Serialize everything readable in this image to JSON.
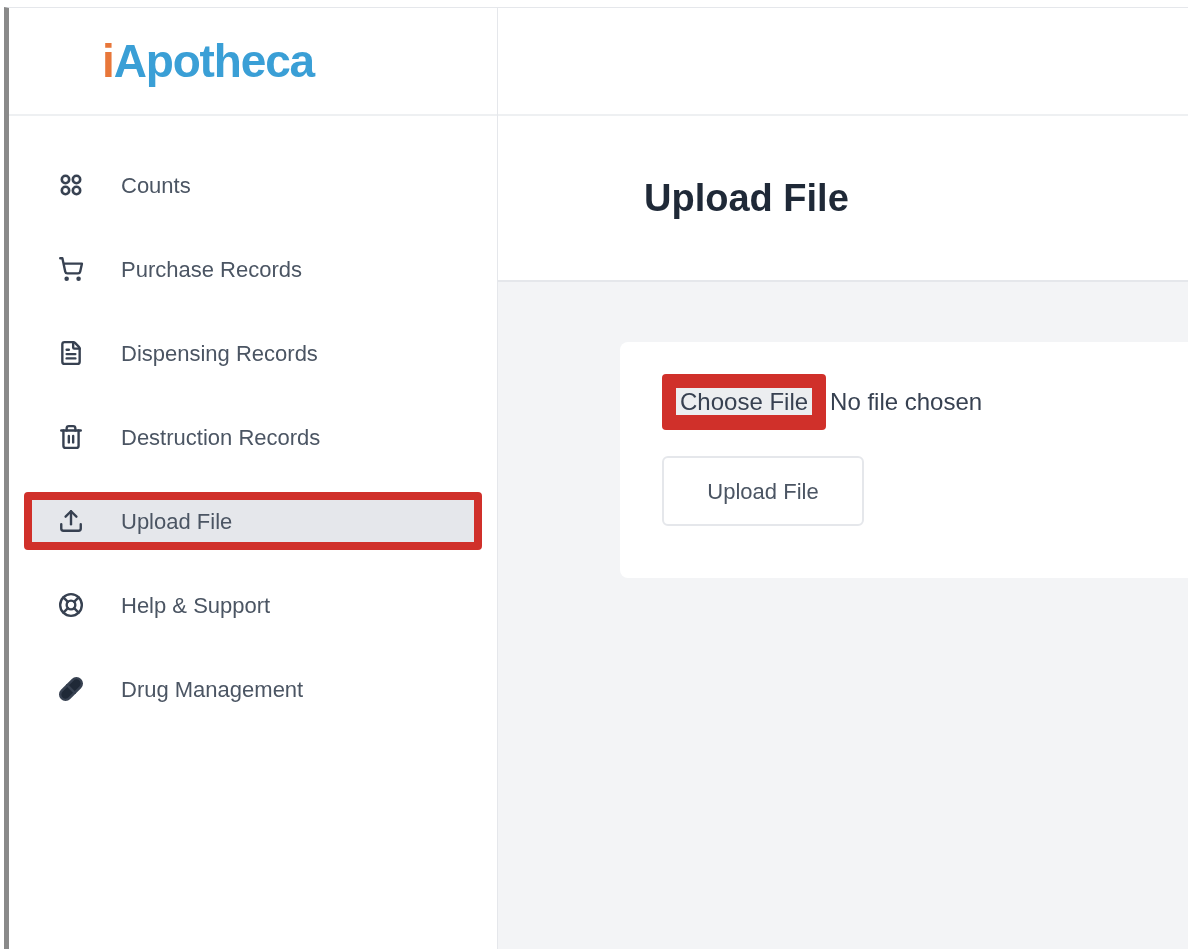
{
  "logo": {
    "prefix": "i",
    "name": "Apotheca"
  },
  "sidebar": {
    "items": [
      {
        "label": "Counts",
        "selected": false,
        "highlighted": false
      },
      {
        "label": "Purchase Records",
        "selected": false,
        "highlighted": false
      },
      {
        "label": "Dispensing Records",
        "selected": false,
        "highlighted": false
      },
      {
        "label": "Destruction Records",
        "selected": false,
        "highlighted": false
      },
      {
        "label": "Upload File",
        "selected": true,
        "highlighted": true
      },
      {
        "label": "Help & Support",
        "selected": false,
        "highlighted": false
      },
      {
        "label": "Drug Management",
        "selected": false,
        "highlighted": false
      }
    ]
  },
  "page_title": "Upload File",
  "upload_card": {
    "choose_button": {
      "label": "Choose File",
      "highlighted": true
    },
    "file_status": "No file chosen",
    "upload_button": "Upload File"
  }
}
